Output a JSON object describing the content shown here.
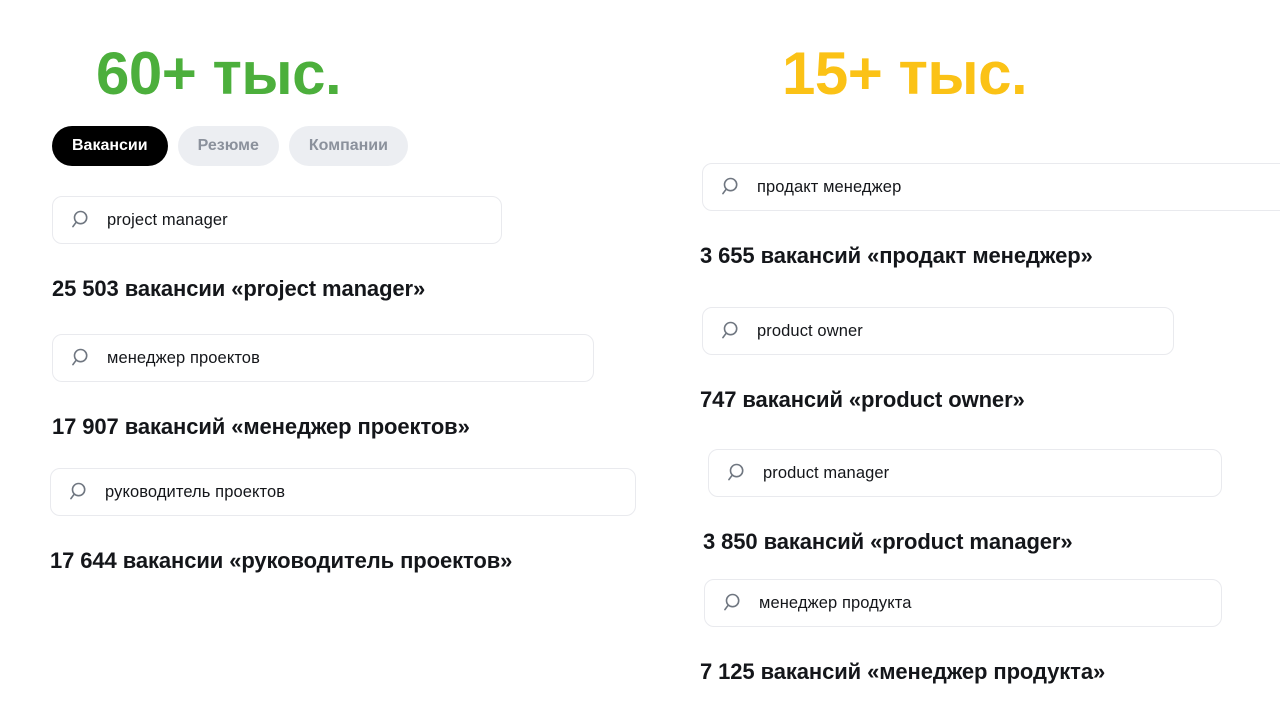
{
  "left": {
    "stat": "60+ тыс.",
    "stat_color": "#4caf3c",
    "tabs": [
      {
        "label": "Вакансии",
        "state": "active"
      },
      {
        "label": "Резюме",
        "state": "inactive"
      },
      {
        "label": "Компании",
        "state": "inactive"
      }
    ],
    "rows": [
      {
        "query": "project manager",
        "result": "25 503 вакансии «project manager»"
      },
      {
        "query": "менеджер проектов",
        "result": "17 907 вакансий «менеджер проектов»"
      },
      {
        "query": "руководитель проектов",
        "result": "17 644 вакансии «руководитель проектов»"
      }
    ]
  },
  "right": {
    "stat": "15+ тыс.",
    "stat_color": "#fbc216",
    "rows": [
      {
        "query": "продакт менеджер",
        "result": "3 655 вакансий «продакт менеджер»"
      },
      {
        "query": "product owner",
        "result": "747 вакансий «product owner»"
      },
      {
        "query": "product manager",
        "result": "3 850 вакансий «product manager»"
      },
      {
        "query": "менеджер продукта",
        "result": "7 125 вакансий «менеджер продукта»"
      }
    ]
  },
  "icons": {
    "search": "search-icon"
  }
}
